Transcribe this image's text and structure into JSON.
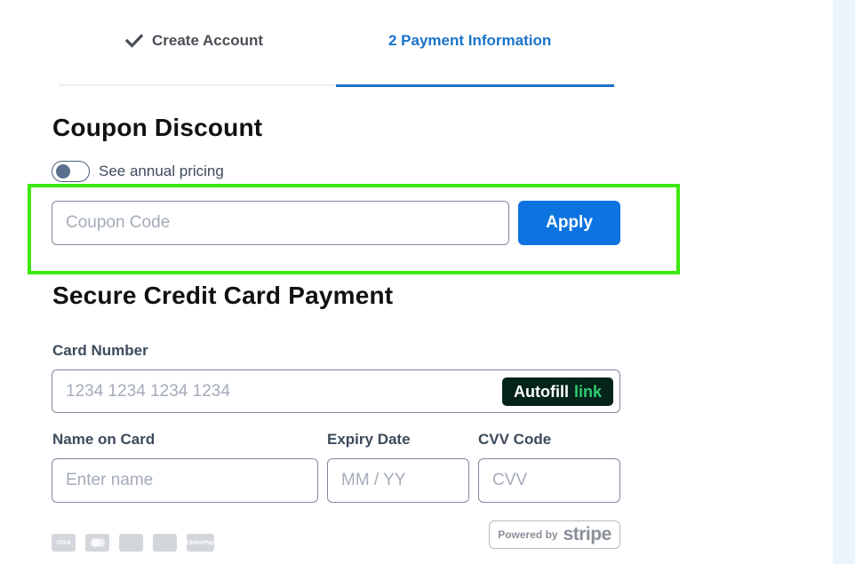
{
  "steps": {
    "step1_label": "Create Account",
    "step2_label": "2 Payment Information"
  },
  "coupon": {
    "title": "Coupon Discount",
    "toggle_label": "See annual pricing",
    "toggle_on": false,
    "input_placeholder": "Coupon Code",
    "apply_label": "Apply"
  },
  "payment": {
    "title": "Secure Credit Card Payment",
    "card_number_label": "Card Number",
    "card_number_placeholder": "1234 1234 1234 1234",
    "autofill_label": "Autofill",
    "autofill_link": "link",
    "name_label": "Name on Card",
    "name_placeholder": "Enter name",
    "expiry_label": "Expiry Date",
    "expiry_placeholder": "MM / YY",
    "cvv_label": "CVV Code",
    "cvv_placeholder": "CVV",
    "card_logos": [
      "VISA",
      "",
      "",
      "",
      "UnionPay"
    ],
    "powered_by": "Powered by",
    "stripe": "stripe"
  },
  "colors": {
    "accent": "#1a73c9",
    "button": "#0d73e0",
    "highlight": "#3ce80f",
    "autofill_bg": "#04231a",
    "link_green": "#2ecc71"
  }
}
